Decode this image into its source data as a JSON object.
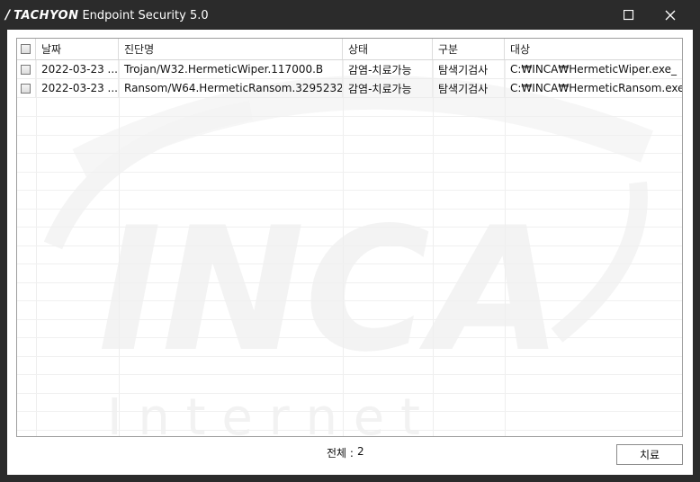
{
  "titlebar": {
    "logo": "TACHYON",
    "title": "Endpoint Security 5.0"
  },
  "table": {
    "columns": [
      "날짜",
      "진단명",
      "상태",
      "구분",
      "대상"
    ],
    "rows": [
      {
        "date": "2022-03-23 ...",
        "name": "Trojan/W32.HermeticWiper.117000.B",
        "status": "감염-치료가능",
        "type": "탐색기검사",
        "target": "C:₩INCA₩HermeticWiper.exe_"
      },
      {
        "date": "2022-03-23 ...",
        "name": "Ransom/W64.HermeticRansom.3295232",
        "status": "감염-치료가능",
        "type": "탐색기검사",
        "target": "C:₩INCA₩HermeticRansom.exe_"
      }
    ]
  },
  "watermark": {
    "text": "INCA",
    "subtext": "I n t e r n e t"
  },
  "footer": {
    "total_label": "전체 :",
    "total_value": "2",
    "treat_button": "치료"
  }
}
